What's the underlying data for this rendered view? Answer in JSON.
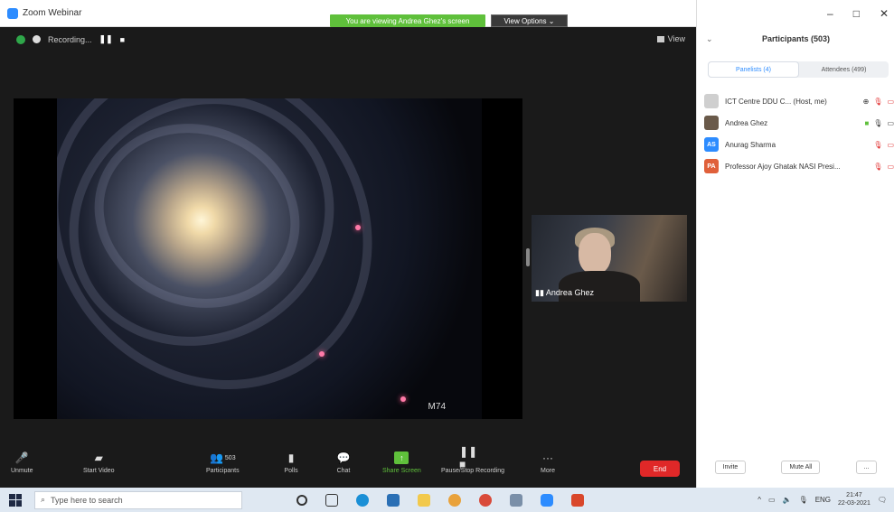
{
  "window": {
    "title": "Zoom Webinar"
  },
  "banner": {
    "sharing_text": "You are viewing Andrea Ghez's screen",
    "view_options": "View Options ⌄"
  },
  "recording": {
    "label": "Recording...",
    "pause": "❚❚",
    "stop": "■"
  },
  "view_label": "View",
  "shared_content": {
    "caption": "M74"
  },
  "speaker": {
    "name": "Andrea Ghez"
  },
  "toolbar": {
    "unmute": "Unmute",
    "start_video": "Start Video",
    "participants": "Participants",
    "participants_count": "503",
    "polls": "Polls",
    "chat": "Chat",
    "share_screen": "Share Screen",
    "pause_recording": "Pause/Stop Recording",
    "more": "More",
    "end": "End"
  },
  "panel": {
    "title": "Participants (503)",
    "tabs": [
      "Panelists (4)",
      "Attendees (499)"
    ],
    "participants": [
      {
        "initials": "",
        "name": "ICT Centre DDU C... (Host, me)",
        "avatar_color": "#cfcfcf"
      },
      {
        "initials": "",
        "name": "Andrea Ghez",
        "avatar_color": "#6a5a4a"
      },
      {
        "initials": "AS",
        "name": "Anurag Sharma",
        "avatar_color": "#2d8cff"
      },
      {
        "initials": "PA",
        "name": "Professor Ajoy Ghatak NASI Presi...",
        "avatar_color": "#e0603a"
      }
    ],
    "invite": "Invite",
    "mute_all": "Mute All",
    "more": "..."
  },
  "taskbar": {
    "search_placeholder": "Type here to search",
    "lang": "ENG",
    "time": "21:47",
    "date": "22-03-2021"
  },
  "colors": {
    "zoom_blue": "#2d8cff",
    "share_green": "#5fc03b",
    "end_red": "#e02828"
  }
}
